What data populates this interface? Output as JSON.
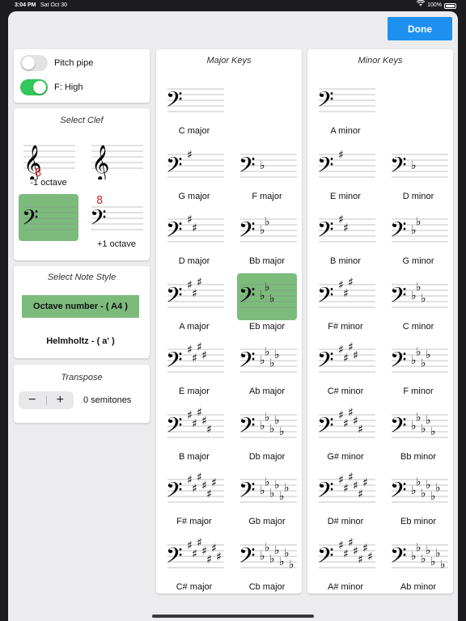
{
  "status_bar": {
    "time": "3:04 PM",
    "date": "Sat Oct 30",
    "battery": "100%"
  },
  "done_label": "Done",
  "settings": {
    "toggles": [
      {
        "label": "Pitch pipe",
        "on": false
      },
      {
        "label": "F: High",
        "on": true
      }
    ]
  },
  "clef": {
    "title": "Select Clef",
    "options": [
      {
        "clef": "treble",
        "octave": "8-below",
        "label": "-1 octave",
        "selected": false
      },
      {
        "clef": "treble",
        "octave": "none",
        "label": "",
        "selected": false
      },
      {
        "clef": "bass",
        "octave": "none",
        "label": "",
        "selected": true
      },
      {
        "clef": "bass",
        "octave": "8-above",
        "label": "+1 octave",
        "selected": false
      }
    ],
    "octave_mark": "8"
  },
  "note_style": {
    "title": "Select Note Style",
    "options": [
      {
        "label": "Octave number - ( A4 )",
        "selected": true
      },
      {
        "label": "Helmholtz - ( a' )",
        "selected": false
      }
    ]
  },
  "transpose": {
    "title": "Transpose",
    "minus": "−",
    "plus": "+",
    "value": "0 semitones"
  },
  "major_keys": {
    "title": "Major Keys",
    "keys": [
      {
        "name": "C major",
        "acc": "",
        "count": 0,
        "selected": false
      },
      {
        "name": "G major",
        "acc": "sharp",
        "count": 1,
        "selected": false
      },
      {
        "name": "F major",
        "acc": "flat",
        "count": 1,
        "selected": false
      },
      {
        "name": "D major",
        "acc": "sharp",
        "count": 2,
        "selected": false
      },
      {
        "name": "Bb major",
        "acc": "flat",
        "count": 2,
        "selected": false
      },
      {
        "name": "A major",
        "acc": "sharp",
        "count": 3,
        "selected": false
      },
      {
        "name": "Eb major",
        "acc": "flat",
        "count": 3,
        "selected": true
      },
      {
        "name": "E major",
        "acc": "sharp",
        "count": 4,
        "selected": false
      },
      {
        "name": "Ab major",
        "acc": "flat",
        "count": 4,
        "selected": false
      },
      {
        "name": "B major",
        "acc": "sharp",
        "count": 5,
        "selected": false
      },
      {
        "name": "Db major",
        "acc": "flat",
        "count": 5,
        "selected": false
      },
      {
        "name": "F# major",
        "acc": "sharp",
        "count": 6,
        "selected": false
      },
      {
        "name": "Gb major",
        "acc": "flat",
        "count": 6,
        "selected": false
      },
      {
        "name": "C# major",
        "acc": "sharp",
        "count": 7,
        "selected": false
      },
      {
        "name": "Cb major",
        "acc": "flat",
        "count": 7,
        "selected": false
      }
    ]
  },
  "minor_keys": {
    "title": "Minor Keys",
    "keys": [
      {
        "name": "A minor",
        "acc": "",
        "count": 0,
        "selected": false
      },
      {
        "name": "E minor",
        "acc": "sharp",
        "count": 1,
        "selected": false
      },
      {
        "name": "D minor",
        "acc": "flat",
        "count": 1,
        "selected": false
      },
      {
        "name": "B minor",
        "acc": "sharp",
        "count": 2,
        "selected": false
      },
      {
        "name": "G minor",
        "acc": "flat",
        "count": 2,
        "selected": false
      },
      {
        "name": "F# minor",
        "acc": "sharp",
        "count": 3,
        "selected": false
      },
      {
        "name": "C minor",
        "acc": "flat",
        "count": 3,
        "selected": false
      },
      {
        "name": "C# minor",
        "acc": "sharp",
        "count": 4,
        "selected": false
      },
      {
        "name": "F minor",
        "acc": "flat",
        "count": 4,
        "selected": false
      },
      {
        "name": "G# minor",
        "acc": "sharp",
        "count": 5,
        "selected": false
      },
      {
        "name": "Bb minor",
        "acc": "flat",
        "count": 5,
        "selected": false
      },
      {
        "name": "D# minor",
        "acc": "sharp",
        "count": 6,
        "selected": false
      },
      {
        "name": "Eb minor",
        "acc": "flat",
        "count": 6,
        "selected": false
      },
      {
        "name": "A# minor",
        "acc": "sharp",
        "count": 7,
        "selected": false
      },
      {
        "name": "Ab minor",
        "acc": "flat",
        "count": 7,
        "selected": false
      }
    ]
  },
  "colors": {
    "accent": "#1e90f0",
    "selected": "#7cbb7c",
    "toggle_on": "#34c759",
    "octave_mark": "#e02020"
  }
}
